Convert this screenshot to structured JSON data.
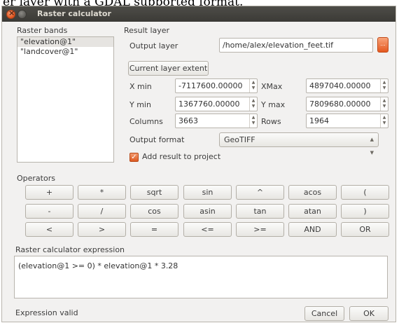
{
  "doc_snippet": "er layer with a GDAL supported format.",
  "window": {
    "title": "Raster calculator"
  },
  "raster_bands": {
    "heading": "Raster bands",
    "items": [
      "\"elevation@1\"",
      "\"landcover@1\""
    ],
    "selected_index": 0
  },
  "result_layer": {
    "heading": "Result layer",
    "output_layer_label": "Output layer",
    "output_layer_value": "/home/alex/elevation_feet.tif",
    "browse_label": "...",
    "current_extent_label": "Current layer extent",
    "xmin_label": "X min",
    "xmin_value": "-7117600.00000",
    "xmax_label": "XMax",
    "xmax_value": "4897040.00000",
    "ymin_label": "Y min",
    "ymin_value": "1367760.00000",
    "ymax_label": "Y max",
    "ymax_value": "7809680.00000",
    "columns_label": "Columns",
    "columns_value": "3663",
    "rows_label": "Rows",
    "rows_value": "1964",
    "format_label": "Output format",
    "format_value": "GeoTIFF",
    "add_result_label": "Add result to project",
    "add_result_checked": true
  },
  "operators": {
    "heading": "Operators",
    "rows": [
      [
        "+",
        "*",
        "sqrt",
        "sin",
        "^",
        "acos",
        "("
      ],
      [
        "-",
        "/",
        "cos",
        "asin",
        "tan",
        "atan",
        ")"
      ],
      [
        "<",
        ">",
        "=",
        "<=",
        ">=",
        "AND",
        "OR"
      ]
    ]
  },
  "expression": {
    "heading": "Raster calculator expression",
    "value": "(elevation@1 >= 0) * elevation@1 * 3.28",
    "status": "Expression valid"
  },
  "buttons": {
    "cancel": "Cancel",
    "ok": "OK"
  },
  "colors": {
    "accent": "#e5581f",
    "titlebar": "#3b3a36",
    "window_bg": "#f2f1f0"
  }
}
